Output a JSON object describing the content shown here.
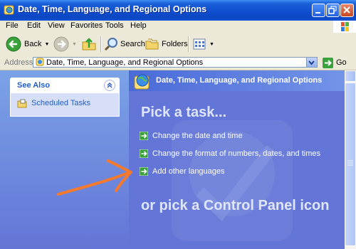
{
  "window": {
    "title": "Date, Time, Language, and Regional Options",
    "colors": {
      "titlebar": "#0f4fd0",
      "task_pane": "#6375d6",
      "link": "#215dc6",
      "annotation": "#f57a2e"
    }
  },
  "menu": {
    "items": [
      "File",
      "Edit",
      "View",
      "Favorites",
      "Tools",
      "Help"
    ]
  },
  "toolbar": {
    "back_label": "Back",
    "search_label": "Search",
    "folders_label": "Folders"
  },
  "address": {
    "label": "Address",
    "value": "Date, Time, Language, and Regional Options",
    "go_label": "Go"
  },
  "left_pane": {
    "see_also_title": "See Also",
    "links": [
      "Scheduled Tasks"
    ]
  },
  "main": {
    "header": "Date, Time, Language, and Regional Options",
    "pick_task": "Pick a task...",
    "tasks": [
      "Change the date and time",
      "Change the format of numbers, dates, and times",
      "Add other languages"
    ],
    "or_pick": "or pick a Control Panel icon"
  },
  "icons": {
    "title": "globe-clock-icon",
    "back": "back-arrow-icon",
    "forward": "forward-arrow-icon",
    "up": "up-folder-icon",
    "search": "search-icon",
    "folders": "folders-icon",
    "views": "views-icon",
    "go": "go-arrow-icon",
    "task": "green-arrow-icon"
  }
}
